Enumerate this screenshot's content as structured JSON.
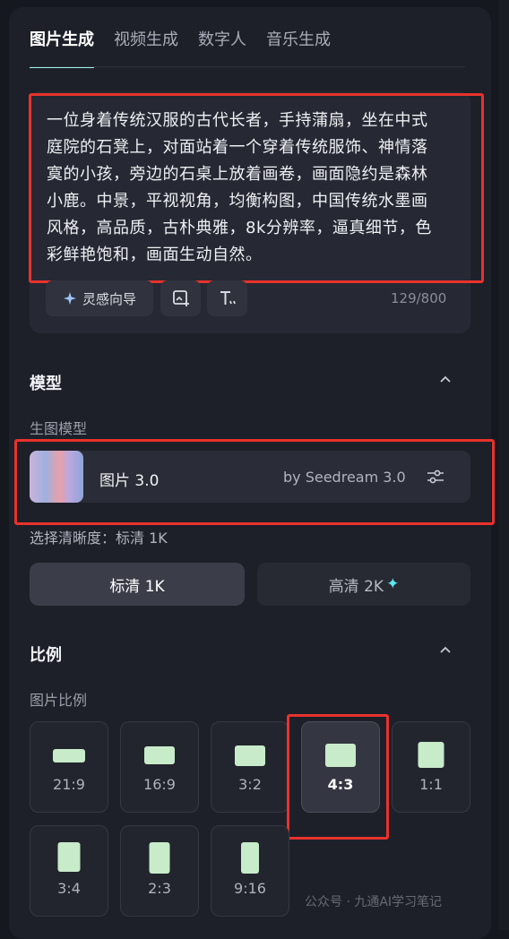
{
  "tabs": [
    {
      "label": "图片生成",
      "active": true
    },
    {
      "label": "视频生成",
      "active": false
    },
    {
      "label": "数字人",
      "active": false
    },
    {
      "label": "音乐生成",
      "active": false
    }
  ],
  "prompt": {
    "text": "一位身着传统汉服的古代长者，手持蒲扇，坐在中式庭院的石凳上，对面站着一个穿着传统服饰、神情落寞的小孩，旁边的石桌上放着画卷，画面隐约是森林小鹿。中景，平视视角，均衡构图，中国传统水墨画风格，高品质，古朴典雅，8k分辨率，逼真细节，色彩鲜艳饱和，画面生动自然。",
    "inspiration_label": "灵感向导",
    "counter": "129/800"
  },
  "model_section": {
    "title": "模型",
    "subtitle": "生图模型",
    "model_name": "图片 3.0",
    "model_by": "by Seedream 3.0"
  },
  "clarity": {
    "label": "选择清晰度：标清 1K",
    "options": [
      {
        "label": "标清 1K",
        "selected": true
      },
      {
        "label": "高清 2K",
        "selected": false
      }
    ]
  },
  "ratio_section": {
    "title": "比例",
    "subtitle": "图片比例",
    "options": [
      {
        "label": "21:9",
        "selected": false
      },
      {
        "label": "16:9",
        "selected": false
      },
      {
        "label": "3:2",
        "selected": false
      },
      {
        "label": "4:3",
        "selected": true
      },
      {
        "label": "1:1",
        "selected": false
      },
      {
        "label": "3:4",
        "selected": false
      },
      {
        "label": "2:3",
        "selected": false
      },
      {
        "label": "9:16",
        "selected": false
      }
    ]
  },
  "watermark": "公众号 · 九通AI学习笔记",
  "colors": {
    "accent": "#9df3e6",
    "highlight": "#e8322c",
    "ratio_shape": "#c8ebc9"
  }
}
